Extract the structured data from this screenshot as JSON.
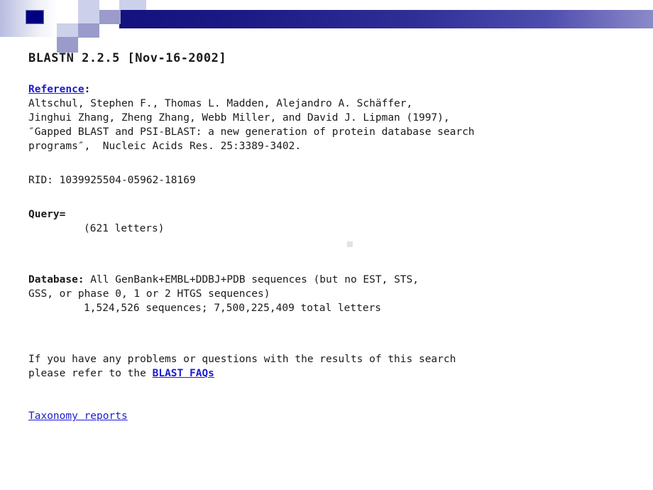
{
  "header": {
    "decoration_name": "blue-gradient-banner",
    "colors": {
      "dark_navy": "#010080",
      "bar_gradient_start": "#13127e",
      "bar_gradient_end": "#8b8ac9",
      "pale_square": "#ccd0ea",
      "medium_square": "#9a9bcb"
    }
  },
  "report": {
    "title": "BLASTN 2.2.5 [Nov-16-2002]",
    "reference": {
      "heading": "Reference",
      "heading_suffix": ":",
      "lines": [
        "Altschul, Stephen F., Thomas L. Madden, Alejandro A. Schäffer,",
        "Jinghui Zhang, Zheng Zhang, Webb Miller, and David J. Lipman (1997),",
        "″Gapped BLAST and PSI-BLAST: a new generation of protein database search",
        "programs″,  Nucleic Acids Res. 25:3389-3402."
      ]
    },
    "rid": {
      "label": "RID:",
      "value": "1039925504-05962-18169",
      "line": "RID: 1039925504-05962-18169"
    },
    "query": {
      "label": "Query=",
      "letters": "(621 letters)"
    },
    "database": {
      "label": "Database:",
      "line1_rest": " All GenBank+EMBL+DDBJ+PDB sequences (but no EST, STS,",
      "line2": "GSS, or phase 0, 1 or 2 HTGS sequences)",
      "counts": "1,524,526 sequences; 7,500,225,409 total letters",
      "sequences_count": "1,524,526",
      "total_letters": "7,500,225,409"
    },
    "help": {
      "line1": "If you have any problems or questions with the results of this search",
      "line2_prefix": "please refer to the ",
      "faq_link": "BLAST FAQs"
    },
    "taxonomy_link": "Taxonomy reports"
  },
  "colors": {
    "link": "#1c1ccc",
    "text": "#1a1a1a",
    "background": "#ffffff"
  }
}
